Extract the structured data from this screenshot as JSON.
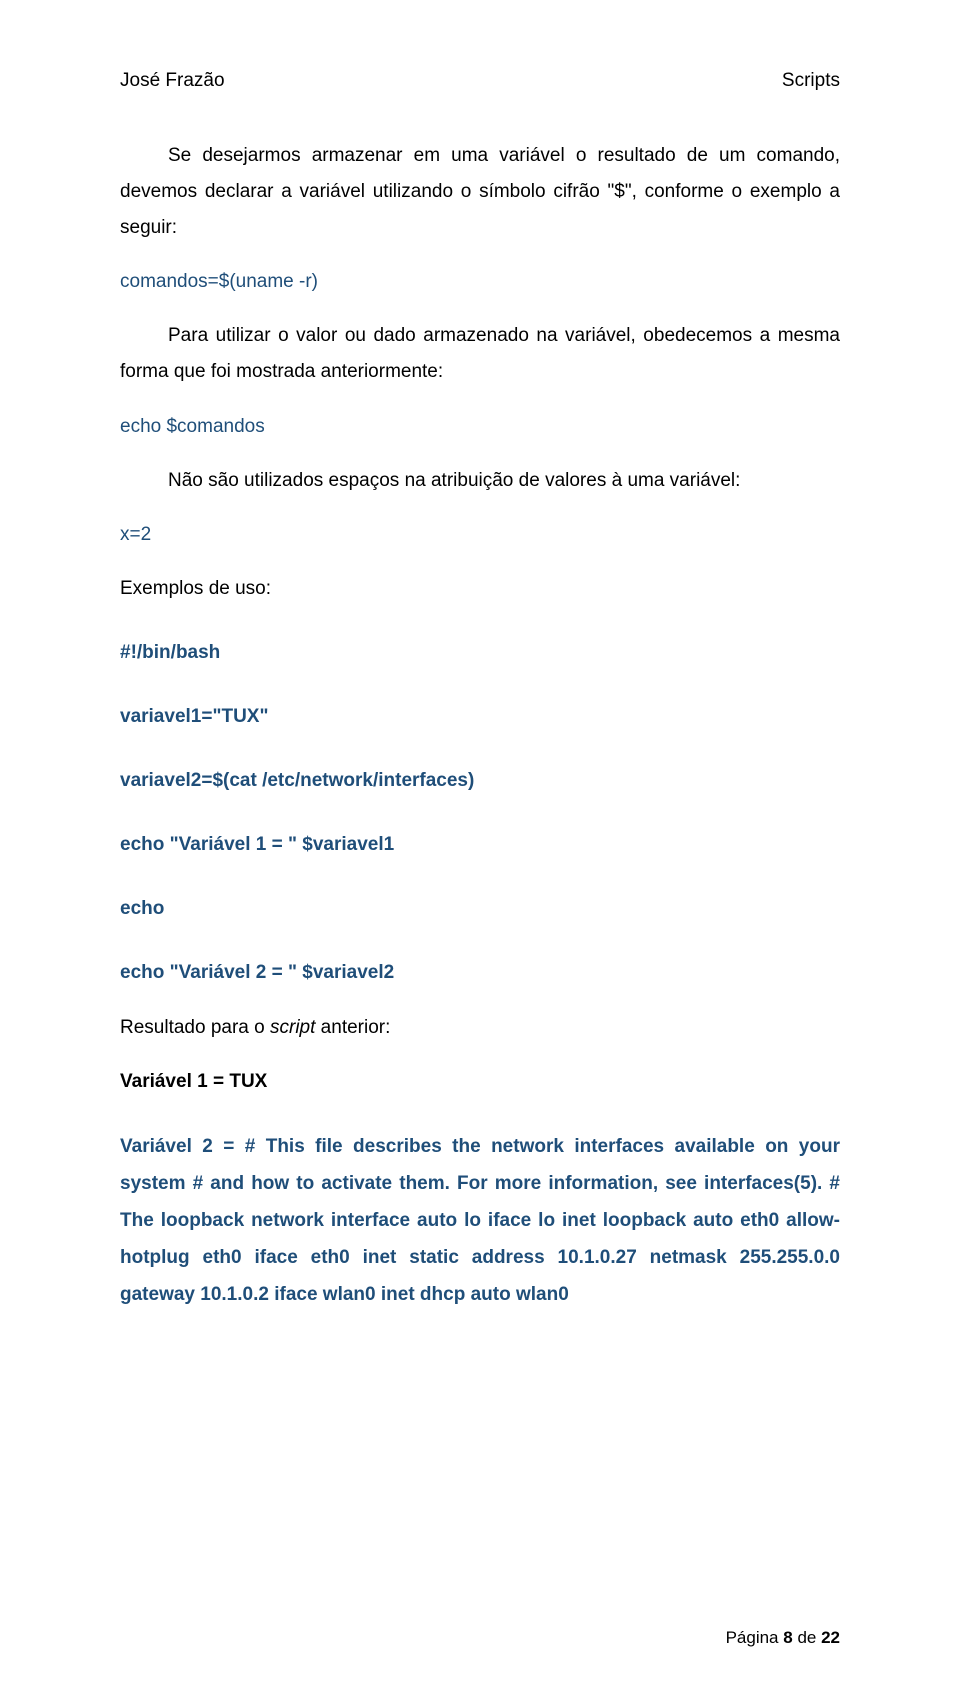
{
  "header": {
    "left": "José Frazão",
    "right": "Scripts"
  },
  "p1": "Se desejarmos armazenar em uma variável o resultado de um comando, devemos declarar a variável utilizando o símbolo cifrão \"$\", conforme o exemplo a seguir:",
  "p2": "comandos=$(uname -r)",
  "p3": "Para utilizar o valor ou dado armazenado na variável, obedecemos a mesma forma que foi mostrada anteriormente:",
  "p4": "echo $comandos",
  "p5": "Não são utilizados espaços na atribuição de valores à uma variável:",
  "p6": "x=2",
  "p7": "Exemplos de uso:",
  "p8": "#!/bin/bash",
  "p9": "variavel1=\"TUX\"",
  "p10": "variavel2=$(cat /etc/network/interfaces)",
  "p11": "echo \"Variável 1 = \" $variavel1",
  "p12": "echo",
  "p13": "echo \"Variável 2 = \" $variavel2",
  "p14a": "Resultado para o ",
  "p14b": "script",
  "p14c": " anterior:",
  "p15": "Variável 1 =  TUX",
  "p16": "Variável 2 =  # This file describes the network interfaces available on your system # and how to activate them. For more information, see interfaces(5). # The loopback network interface auto lo iface lo inet loopback auto eth0 allow-hotplug eth0 iface eth0 inet static address 10.1.0.27 netmask 255.255.0.0 gateway 10.1.0.2 iface wlan0 inet dhcp auto wlan0",
  "footer": {
    "prefix": "Página ",
    "page": "8",
    "mid": " de ",
    "total": "22"
  }
}
